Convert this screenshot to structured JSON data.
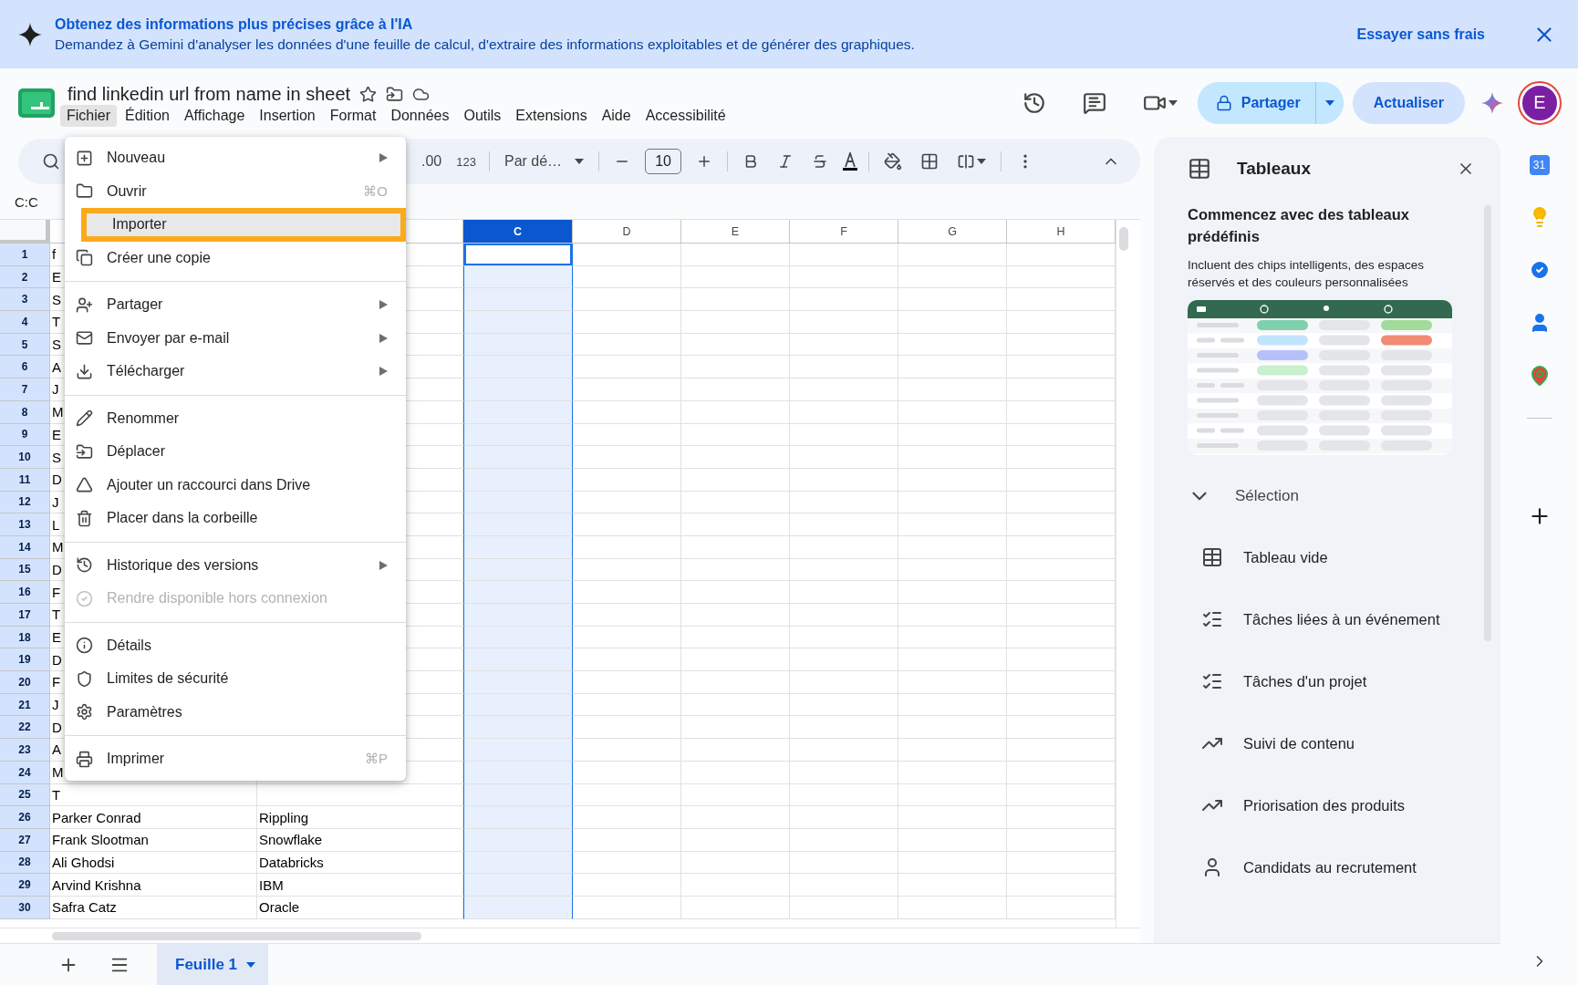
{
  "banner": {
    "title": "Obtenez des informations plus précises grâce à l'IA",
    "message": "Demandez à Gemini d'analyser les données d'une feuille de calcul, d'extraire des informations exploitables et de générer des graphiques.",
    "action": "Essayer sans frais"
  },
  "document": {
    "title": "find linkedin url from name in sheet"
  },
  "menu_bar": [
    {
      "label": "Fichier",
      "selected": true
    },
    {
      "label": "Édition",
      "selected": false
    },
    {
      "label": "Affichage",
      "selected": false
    },
    {
      "label": "Insertion",
      "selected": false
    },
    {
      "label": "Format",
      "selected": false
    },
    {
      "label": "Données",
      "selected": false
    },
    {
      "label": "Outils",
      "selected": false
    },
    {
      "label": "Extensions",
      "selected": false
    },
    {
      "label": "Aide",
      "selected": false
    },
    {
      "label": "Accessibilité",
      "selected": false
    }
  ],
  "header_actions": {
    "share": "Partager",
    "update": "Actualiser",
    "avatar": "E"
  },
  "toolbar": {
    "decimals": ".00",
    "number_format": "123",
    "font": "Par dé…",
    "font_size": "10"
  },
  "name_box": "C:C",
  "sheet": {
    "columns": [
      {
        "label": "C",
        "selected": true
      },
      {
        "label": "D",
        "selected": false
      },
      {
        "label": "E",
        "selected": false
      },
      {
        "label": "F",
        "selected": false
      },
      {
        "label": "G",
        "selected": false
      },
      {
        "label": "H",
        "selected": false
      }
    ],
    "rows": [
      {
        "number": "1",
        "active": true,
        "cells": [
          "f"
        ]
      },
      {
        "number": "2",
        "active": false,
        "cells": [
          "E"
        ]
      },
      {
        "number": "3",
        "active": false,
        "cells": [
          "S"
        ]
      },
      {
        "number": "4",
        "active": false,
        "cells": [
          "T"
        ]
      },
      {
        "number": "5",
        "active": false,
        "cells": [
          "S"
        ]
      },
      {
        "number": "6",
        "active": false,
        "cells": [
          "A"
        ]
      },
      {
        "number": "7",
        "active": false,
        "cells": [
          "J"
        ]
      },
      {
        "number": "8",
        "active": false,
        "cells": [
          "M"
        ]
      },
      {
        "number": "9",
        "active": false,
        "cells": [
          "E"
        ]
      },
      {
        "number": "10",
        "active": false,
        "cells": [
          "S"
        ]
      },
      {
        "number": "11",
        "active": false,
        "cells": [
          "D"
        ]
      },
      {
        "number": "12",
        "active": false,
        "cells": [
          "J"
        ]
      },
      {
        "number": "13",
        "active": false,
        "cells": [
          "L"
        ]
      },
      {
        "number": "14",
        "active": false,
        "cells": [
          "M"
        ]
      },
      {
        "number": "15",
        "active": false,
        "cells": [
          "D"
        ]
      },
      {
        "number": "16",
        "active": false,
        "cells": [
          "F"
        ]
      },
      {
        "number": "17",
        "active": false,
        "cells": [
          "T"
        ]
      },
      {
        "number": "18",
        "active": false,
        "cells": [
          "E"
        ]
      },
      {
        "number": "19",
        "active": false,
        "cells": [
          "D"
        ]
      },
      {
        "number": "20",
        "active": false,
        "cells": [
          "F"
        ]
      },
      {
        "number": "21",
        "active": false,
        "cells": [
          "J"
        ]
      },
      {
        "number": "22",
        "active": false,
        "cells": [
          "D"
        ]
      },
      {
        "number": "23",
        "active": false,
        "cells": [
          "A"
        ]
      },
      {
        "number": "24",
        "active": false,
        "cells": [
          "M"
        ]
      },
      {
        "number": "25",
        "active": false,
        "cells": [
          "T"
        ]
      },
      {
        "number": "26",
        "active": false,
        "cells": [
          "Parker Conrad",
          "Rippling"
        ]
      },
      {
        "number": "27",
        "active": false,
        "cells": [
          "Frank Slootman",
          "Snowflake"
        ]
      },
      {
        "number": "28",
        "active": false,
        "cells": [
          "Ali Ghodsi",
          "Databricks"
        ]
      },
      {
        "number": "29",
        "active": false,
        "cells": [
          "Arvind Krishna",
          "IBM"
        ]
      },
      {
        "number": "30",
        "active": false,
        "cells": [
          "Safra Catz",
          "Oracle"
        ]
      }
    ]
  },
  "file_menu": {
    "groups": [
      [
        {
          "label": "Nouveau",
          "submenu": true,
          "disabled": false,
          "selected": false
        },
        {
          "label": "Ouvrir",
          "shortcut": "⌘O",
          "submenu": false,
          "disabled": false,
          "selected": false
        },
        {
          "label": "Importer",
          "submenu": false,
          "disabled": false,
          "selected": true
        },
        {
          "label": "Créer une copie",
          "submenu": false,
          "disabled": false,
          "selected": false
        }
      ],
      [
        {
          "label": "Partager",
          "submenu": true,
          "disabled": false,
          "selected": false
        },
        {
          "label": "Envoyer par e-mail",
          "submenu": true,
          "disabled": false,
          "selected": false
        },
        {
          "label": "Télécharger",
          "submenu": true,
          "disabled": false,
          "selected": false
        }
      ],
      [
        {
          "label": "Renommer",
          "submenu": false,
          "disabled": false,
          "selected": false
        },
        {
          "label": "Déplacer",
          "submenu": false,
          "disabled": false,
          "selected": false
        },
        {
          "label": "Ajouter un raccourci dans Drive",
          "submenu": false,
          "disabled": false,
          "selected": false
        },
        {
          "label": "Placer dans la corbeille",
          "submenu": false,
          "disabled": false,
          "selected": false
        }
      ],
      [
        {
          "label": "Historique des versions",
          "submenu": true,
          "disabled": false,
          "selected": false
        },
        {
          "label": "Rendre disponible hors connexion",
          "submenu": false,
          "disabled": true,
          "selected": false
        }
      ],
      [
        {
          "label": "Détails",
          "submenu": false,
          "disabled": false,
          "selected": false
        },
        {
          "label": "Limites de sécurité",
          "submenu": false,
          "disabled": false,
          "selected": false
        },
        {
          "label": "Paramètres",
          "submenu": false,
          "disabled": false,
          "selected": false
        }
      ],
      [
        {
          "label": "Imprimer",
          "shortcut": "⌘P",
          "submenu": false,
          "disabled": false,
          "selected": false
        }
      ]
    ]
  },
  "panel": {
    "title": "Tableaux",
    "heading": "Commencez avec des tableaux prédéfinis",
    "description": "Incluent des chips intelligents, des espaces réservés et des couleurs personnalisées",
    "section": {
      "label": "Sélection",
      "expanded": true
    },
    "templates": [
      "Tableau vide",
      "Tâches liées à un événement",
      "Tâches d'un projet",
      "Suivi de contenu",
      "Priorisation des produits",
      "Candidats au recrutement"
    ]
  },
  "side_rail": {
    "calendar_day": "31"
  },
  "sheet_tabs": [
    {
      "label": "Feuille 1",
      "selected": true
    }
  ]
}
